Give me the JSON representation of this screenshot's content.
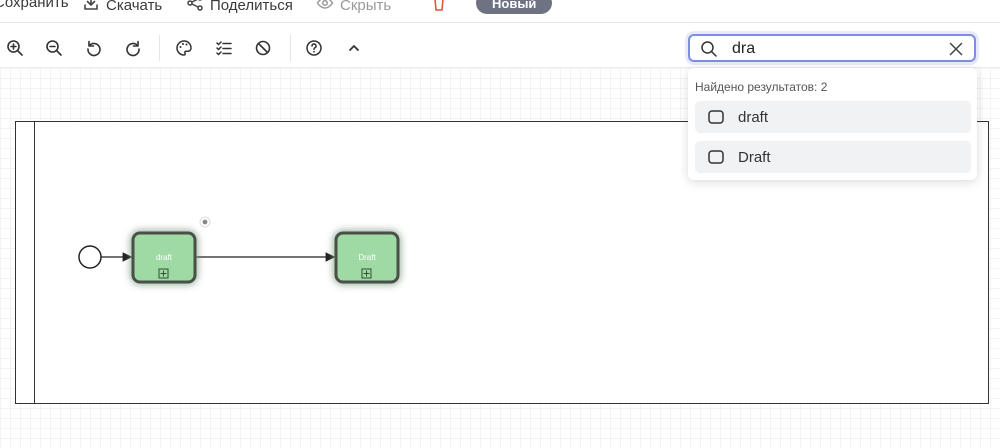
{
  "topbar": {
    "save_label": "Сохранить",
    "download_label": "Скачать",
    "share_label": "Поделиться",
    "hide_label": "Скрыть",
    "badge_label": "Новый"
  },
  "toolbar": {
    "buttons": [
      "zoom-in-icon",
      "zoom-out-icon",
      "undo-icon",
      "redo-icon",
      "palette-icon",
      "checklist-icon",
      "block-icon",
      "help-icon",
      "chevron-up-icon"
    ]
  },
  "search": {
    "value": "dra",
    "placeholder": "",
    "results_count_text": "Найдено результатов: 2",
    "results": [
      {
        "label": "draft"
      },
      {
        "label": "Draft"
      }
    ]
  },
  "diagram": {
    "tasks": [
      {
        "label": "draft"
      },
      {
        "label": "Draft"
      }
    ],
    "task_fill": "#9fd9a4",
    "task_glow": "#7ed67f"
  }
}
